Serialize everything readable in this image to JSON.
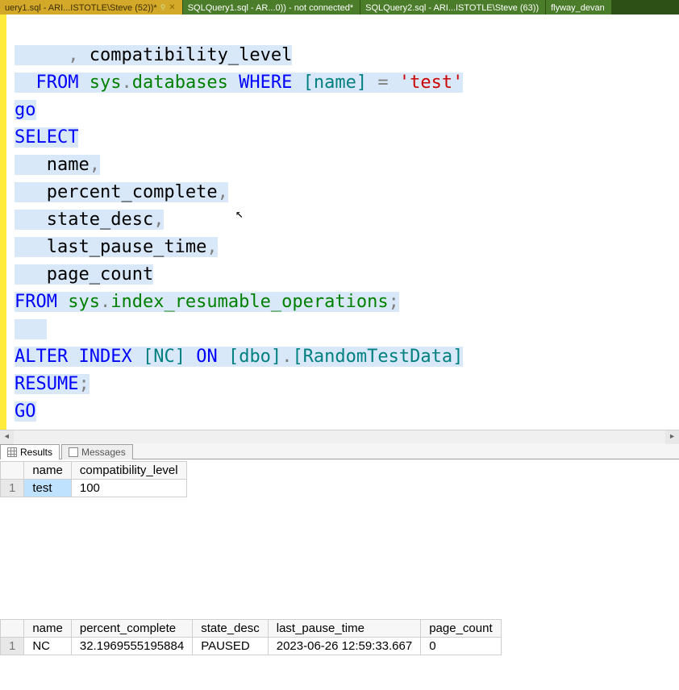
{
  "tabs": [
    {
      "label": "uery1.sql - ARI...ISTOTLE\\Steve (52))*",
      "active": true
    },
    {
      "label": "SQLQuery1.sql - AR...0)) - not connected*",
      "active": false
    },
    {
      "label": "SQLQuery2.sql - ARI...ISTOTLE\\Steve (63))",
      "active": false
    },
    {
      "label": "flyway_devan",
      "active": false
    }
  ],
  "code": {
    "l1_a": "     ,",
    "l1_b": " compatibility_level",
    "l2_a": "  FROM",
    "l2_b": " sys",
    "l2_c": ".",
    "l2_d": "databases",
    "l2_e": " WHERE",
    "l2_f": " [name]",
    "l2_g": " =",
    "l2_h": " 'test'",
    "l3": "go",
    "l4": "SELECT",
    "l5_a": "   name",
    "l5_b": ",",
    "l6_a": "   percent_complete",
    "l6_b": ",",
    "l7_a": "   state_desc",
    "l7_b": ",",
    "l8_a": "   last_pause_time",
    "l8_b": ",",
    "l9": "   page_count",
    "l10_a": "FROM",
    "l10_b": " sys",
    "l10_c": ".",
    "l10_d": "index_resumable_operations",
    "l10_e": ";",
    "l11_pad": "   ",
    "l12_a": "ALTER",
    "l12_b": " INDEX",
    "l12_c": " [NC]",
    "l12_d": " ON",
    "l12_e": " [dbo]",
    "l12_f": ".",
    "l12_g": "[RandomTestData]",
    "l13_a": "RESUME",
    "l13_b": ";",
    "l14": "GO"
  },
  "results_tabs": {
    "results": "Results",
    "messages": "Messages"
  },
  "chart_data": [
    {
      "type": "table",
      "columns": [
        "name",
        "compatibility_level"
      ],
      "rows": [
        {
          "name": "test",
          "compatibility_level": "100"
        }
      ]
    },
    {
      "type": "table",
      "columns": [
        "name",
        "percent_complete",
        "state_desc",
        "last_pause_time",
        "page_count"
      ],
      "rows": [
        {
          "name": "NC",
          "percent_complete": "32.1969555195884",
          "state_desc": "PAUSED",
          "last_pause_time": "2023-06-26 12:59:33.667",
          "page_count": "0"
        }
      ]
    }
  ]
}
